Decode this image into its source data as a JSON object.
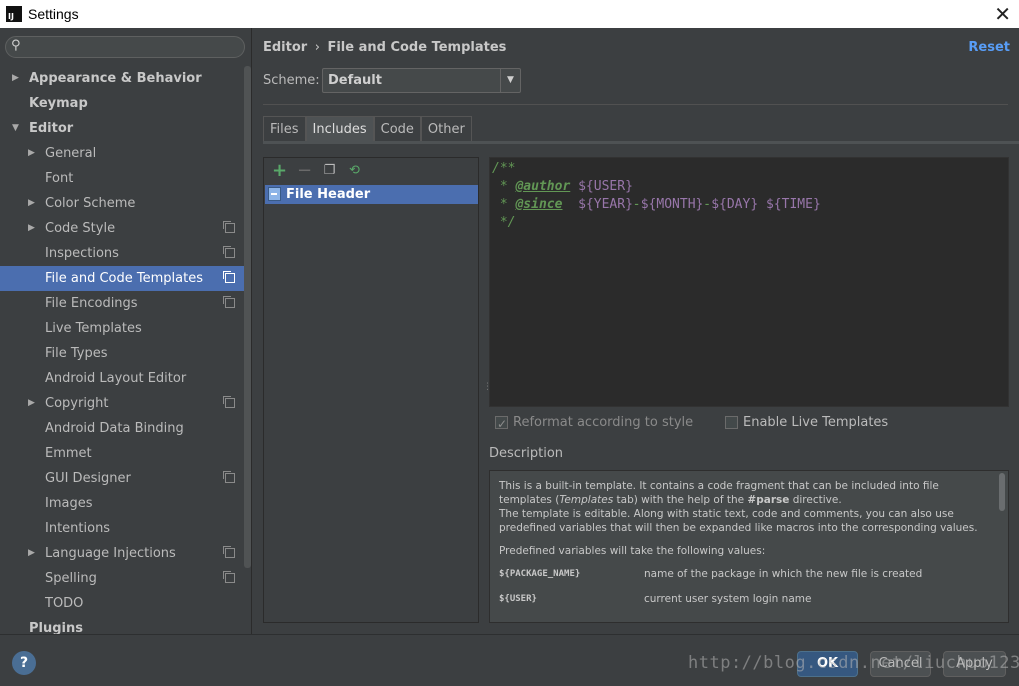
{
  "window": {
    "title": "Settings",
    "app_icon_text": "IJ"
  },
  "search": {
    "placeholder": ""
  },
  "sidebar": {
    "items": [
      {
        "label": "Appearance & Behavior"
      },
      {
        "label": "Keymap"
      },
      {
        "label": "Editor"
      },
      {
        "label": "General"
      },
      {
        "label": "Font"
      },
      {
        "label": "Color Scheme"
      },
      {
        "label": "Code Style"
      },
      {
        "label": "Inspections"
      },
      {
        "label": "File and Code Templates"
      },
      {
        "label": "File Encodings"
      },
      {
        "label": "Live Templates"
      },
      {
        "label": "File Types"
      },
      {
        "label": "Android Layout Editor"
      },
      {
        "label": "Copyright"
      },
      {
        "label": "Android Data Binding"
      },
      {
        "label": "Emmet"
      },
      {
        "label": "GUI Designer"
      },
      {
        "label": "Images"
      },
      {
        "label": "Intentions"
      },
      {
        "label": "Language Injections"
      },
      {
        "label": "Spelling"
      },
      {
        "label": "TODO"
      },
      {
        "label": "Plugins"
      }
    ]
  },
  "header": {
    "crumb_parent": "Editor",
    "crumb_sep": "›",
    "crumb_current": "File and Code Templates",
    "reset_label": "Reset"
  },
  "scheme": {
    "label": "Scheme:",
    "value": "Default"
  },
  "tabs": [
    {
      "label": "Files"
    },
    {
      "label": "Includes"
    },
    {
      "label": "Code"
    },
    {
      "label": "Other"
    }
  ],
  "template_list": {
    "items": [
      {
        "label": "File Header"
      }
    ]
  },
  "editor": {
    "line1": "/**",
    "line2_prefix": " * ",
    "line2_tag": "@author",
    "line2_space": " ",
    "line2_var": "${USER}",
    "line3_prefix": " * ",
    "line3_tag": "@since",
    "line3_space": "  ",
    "line3_v1": "${YEAR}",
    "line3_d1": "-",
    "line3_v2": "${MONTH}",
    "line3_d2": "-",
    "line3_v3": "${DAY}",
    "line3_sp": " ",
    "line3_v4": "${TIME}",
    "line4": " */"
  },
  "options": {
    "reformat_label": "Reformat according to style",
    "reformat_checked": true,
    "live_templates_label": "Enable Live Templates",
    "live_templates_checked": false
  },
  "description": {
    "label": "Description",
    "p1a": "This is a built-in template. It contains a code fragment that can be included into file templates (",
    "p1b": "Templates",
    "p1c": " tab) with the help of the ",
    "p1d": "#parse",
    "p1e": " directive.",
    "p1f": "The template is editable. Along with static text, code and comments, you can also use predefined variables that will then be expanded like macros into the corresponding values.",
    "p2": "Predefined variables will take the following values:",
    "vars": [
      {
        "name": "${PACKAGE_NAME}",
        "desc": "name of the package in which the new file is created"
      },
      {
        "name": "${USER}",
        "desc": "current user system login name"
      }
    ]
  },
  "footer": {
    "help_label": "?",
    "ok_label": "OK",
    "cancel_label": "Cancel",
    "apply_label": "Apply"
  },
  "watermark": "http://blog.csdn.net/liuchuo123",
  "colors": {
    "accent": "#4b6eaf",
    "link": "#589df6",
    "comment": "#629755",
    "variable": "#9876aa",
    "add": "#59a869"
  }
}
